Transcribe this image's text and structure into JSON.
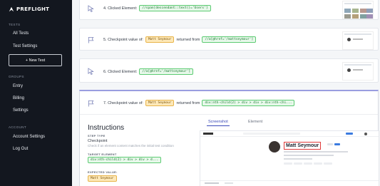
{
  "app": {
    "logo_text": "PREFLIGHT"
  },
  "sidebar": {
    "tests_label": "TESTS",
    "tests_items": [
      {
        "label": "All Tests"
      },
      {
        "label": "Test Settings"
      }
    ],
    "new_test_label": "+ New Test",
    "groups_label": "GROUPS",
    "groups_items": [
      {
        "label": "Entry"
      },
      {
        "label": "Billing"
      },
      {
        "label": "Settings"
      }
    ],
    "account_label": "ACCOUNT",
    "account_items": [
      {
        "label": "Account Settings"
      },
      {
        "label": "Log Out"
      }
    ]
  },
  "steps": [
    {
      "icon": "cursor-icon",
      "prefix": "4. Clicked Element:",
      "selector": "//span[descendant::text()='Users']"
    },
    {
      "icon": "flag-icon",
      "prefix": "5. Checkpoint value of:",
      "value": "Matt Seymour",
      "returned": "returned from",
      "selector": "//a[@href='/mattseymour']"
    },
    {
      "icon": "cursor-icon",
      "prefix": "6. Clicked Element:",
      "selector": "//a[@href='/mattseymour']"
    },
    {
      "icon": "flag-icon",
      "prefix": "7. Checkpoint value of:",
      "value": "Matt Seymour",
      "returned": "returned from",
      "selector": "div:nth-child(2) > div > div > div:nth-chi..."
    }
  ],
  "instructions": {
    "title": "Instructions",
    "step_type_label": "STEP TYPE",
    "step_type_value": "Checkpoint",
    "step_type_help": "Check if an element content matches the initial test condition",
    "target_label": "TARGET ELEMENT",
    "target_value": "div:nth-child(2) > div > div > d...",
    "expected_label": "EXPECTED VALUE:",
    "expected_value": "Matt Seymour"
  },
  "tabs": [
    {
      "label": "Screenshot",
      "active": true
    },
    {
      "label": "Element",
      "active": false
    }
  ],
  "preview": {
    "name": "Matt Seymour"
  }
}
